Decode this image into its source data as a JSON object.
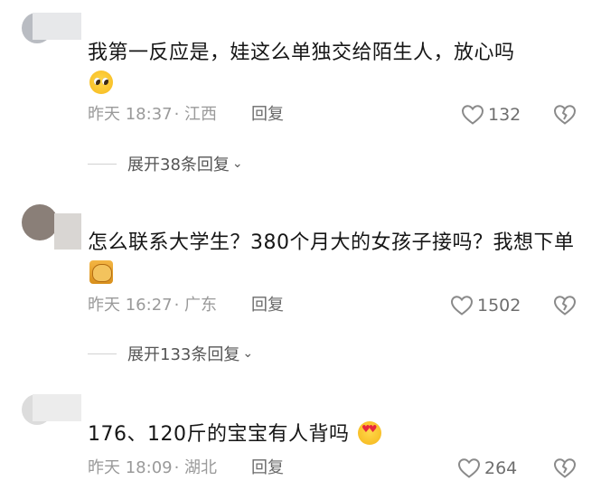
{
  "comments": [
    {
      "text": "我第一反应是，娃这么单独交给陌生人，放心吗",
      "emoji": "pleading-face-emoji",
      "time": "昨天 18:37",
      "location": "· 江西",
      "reply_label": "回复",
      "likes": "132",
      "expand_label": "展开38条回复",
      "expand_chevron": "⌄"
    },
    {
      "text": "怎么联系大学生？380个月大的女孩子接吗？我想下单",
      "emoji": "cat-sticker-emoji",
      "time": "昨天 16:27",
      "location": "· 广东",
      "reply_label": "回复",
      "likes": "1502",
      "expand_label": "展开133条回复",
      "expand_chevron": "⌄"
    },
    {
      "text": "176、120斤的宝宝有人背吗",
      "emoji": "heart-eyes-emoji",
      "time": "昨天 18:09",
      "location": "· 湖北",
      "reply_label": "回复",
      "likes": "264"
    }
  ],
  "colors": {
    "text": "#161616",
    "meta": "#9a9a9a",
    "icon": "#8a8a8a"
  }
}
